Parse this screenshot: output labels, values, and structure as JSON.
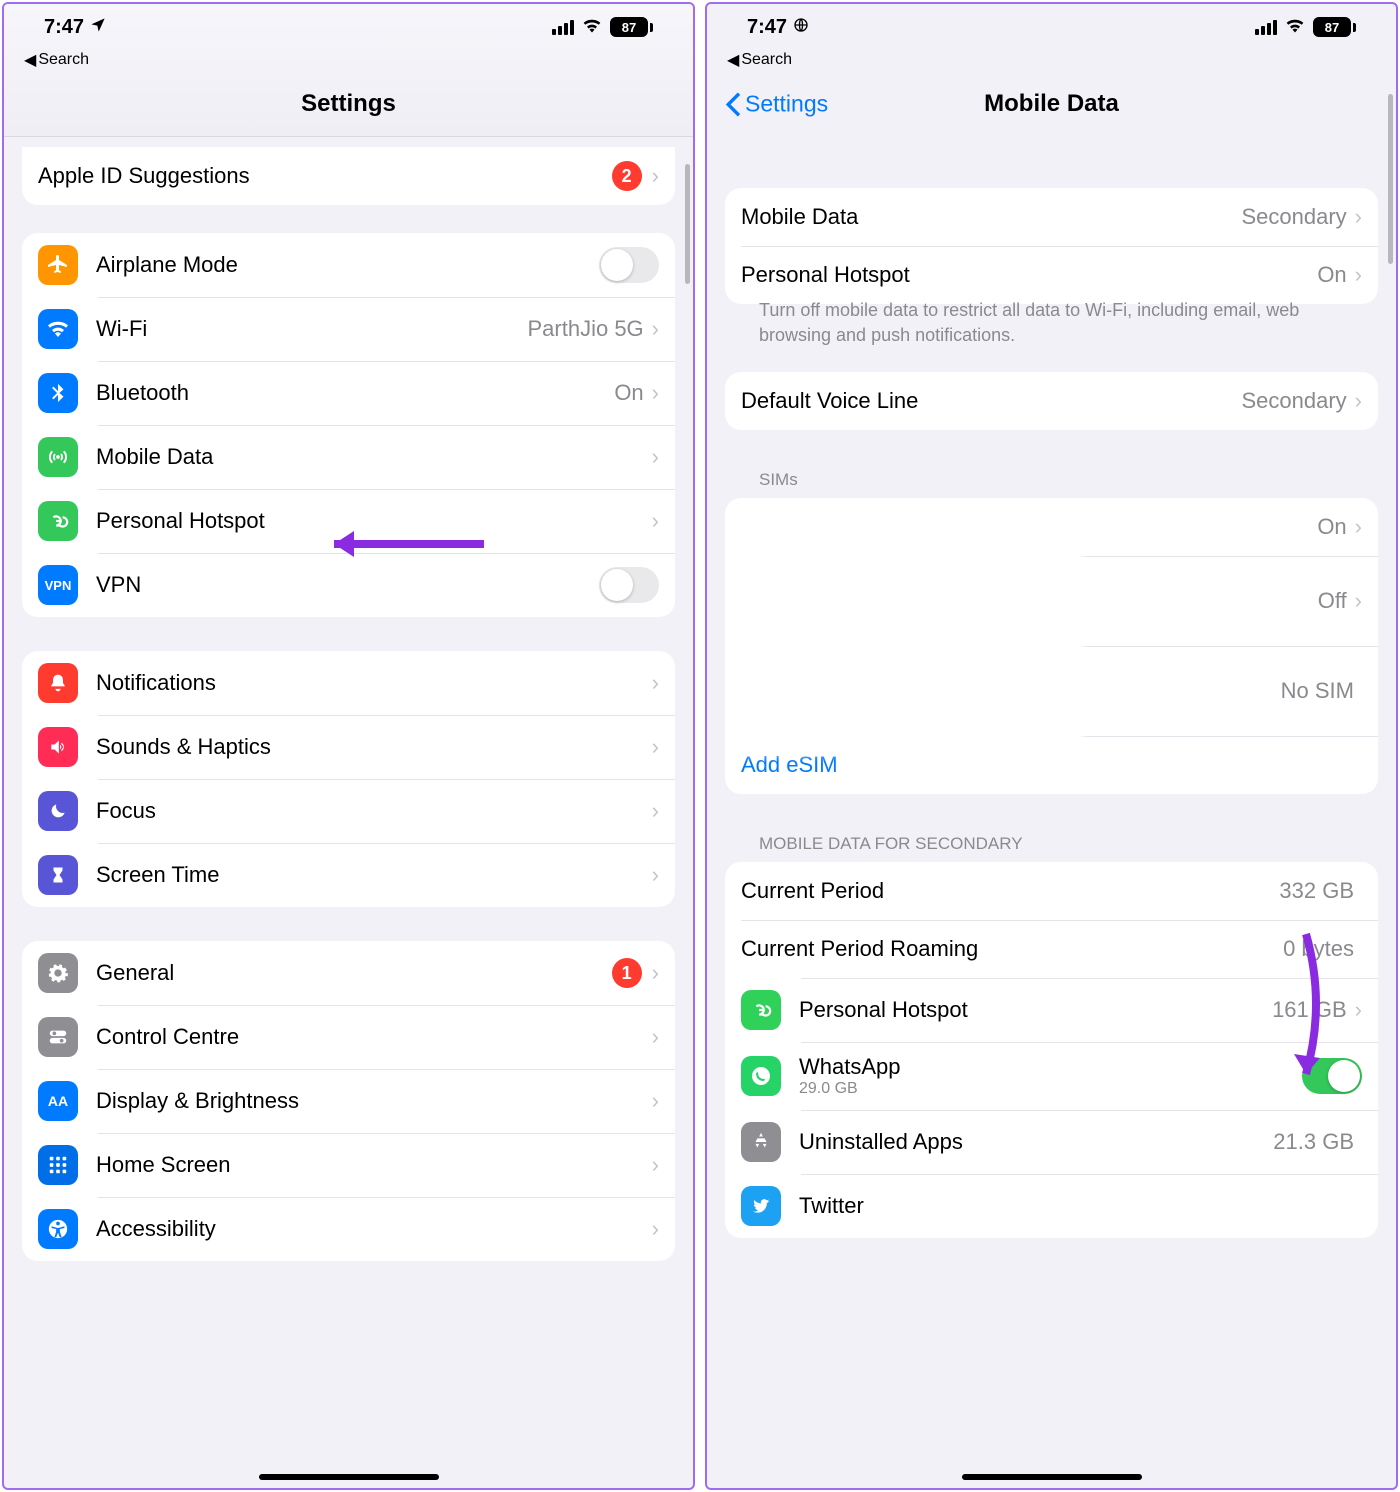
{
  "left": {
    "status": {
      "time": "7:47",
      "battery": "87"
    },
    "back_search": "Search",
    "title": "Settings",
    "apple_id": {
      "label": "Apple ID Suggestions",
      "badge": "2"
    },
    "group1": {
      "airplane": "Airplane Mode",
      "wifi": {
        "label": "Wi-Fi",
        "value": "ParthJio 5G"
      },
      "bluetooth": {
        "label": "Bluetooth",
        "value": "On"
      },
      "mobile_data": "Mobile Data",
      "hotspot": "Personal Hotspot",
      "vpn": "VPN"
    },
    "group2": {
      "notifications": "Notifications",
      "sounds": "Sounds & Haptics",
      "focus": "Focus",
      "screentime": "Screen Time"
    },
    "group3": {
      "general": {
        "label": "General",
        "badge": "1"
      },
      "control": "Control Centre",
      "display": "Display & Brightness",
      "home": "Home Screen",
      "accessibility": "Accessibility"
    }
  },
  "right": {
    "status": {
      "time": "7:47",
      "battery": "87"
    },
    "back_search": "Search",
    "nav_back": "Settings",
    "nav_title": "Mobile Data",
    "group1": {
      "mobile_data": {
        "label": "Mobile Data",
        "value": "Secondary"
      },
      "hotspot": {
        "label": "Personal Hotspot",
        "value": "On"
      }
    },
    "footer1": "Turn off mobile data to restrict all data to Wi-Fi, including email, web browsing and push notifications.",
    "group2": {
      "voice": {
        "label": "Default Voice Line",
        "value": "Secondary"
      }
    },
    "sims_header": "SIMs",
    "sims": {
      "sim1_value": "On",
      "sim2_value": "Off",
      "sim3_value": "No SIM",
      "add_esim": "Add eSIM"
    },
    "usage_header": "MOBILE DATA FOR SECONDARY",
    "usage": {
      "period": {
        "label": "Current Period",
        "value": "332 GB"
      },
      "roaming": {
        "label": "Current Period Roaming",
        "value": "0 bytes"
      },
      "hotspot": {
        "label": "Personal Hotspot",
        "value": "161 GB"
      },
      "whatsapp": {
        "label": "WhatsApp",
        "sub": "29.0 GB"
      },
      "uninstalled": {
        "label": "Uninstalled Apps",
        "value": "21.3 GB"
      },
      "twitter": "Twitter"
    }
  }
}
